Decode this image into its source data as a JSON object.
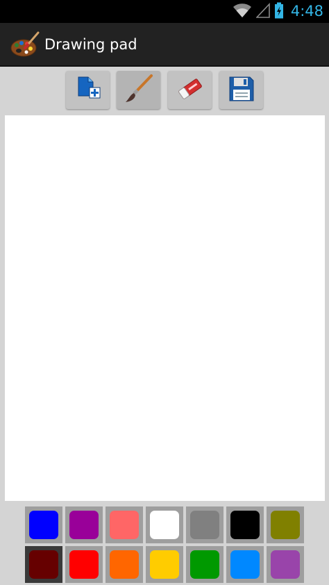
{
  "status_bar": {
    "time": "4:48",
    "icons": [
      "wifi-icon",
      "signal-icon",
      "battery-charging-icon"
    ]
  },
  "action_bar": {
    "title": "Drawing pad",
    "icon": "palette-icon"
  },
  "toolbar": {
    "buttons": [
      {
        "name": "new-drawing-button",
        "icon": "new-page-icon",
        "selected": false
      },
      {
        "name": "brush-button",
        "icon": "brush-icon",
        "selected": true
      },
      {
        "name": "eraser-button",
        "icon": "eraser-icon",
        "selected": false
      },
      {
        "name": "save-button",
        "icon": "floppy-disk-icon",
        "selected": false
      }
    ]
  },
  "palette": {
    "rows": [
      [
        "#0000ff",
        "#990099",
        "#ff6666",
        "#ffffff",
        "#808080",
        "#000000",
        "#808000"
      ],
      [
        "#660000",
        "#ff0000",
        "#ff6600",
        "#ffcc00",
        "#009900",
        "#0088ff",
        "#9944aa"
      ]
    ],
    "selected": "#660000"
  },
  "colors": {
    "status_time": "#33b5e5",
    "action_bar": "#222222",
    "background": "#d4d4d4",
    "canvas": "#ffffff"
  }
}
